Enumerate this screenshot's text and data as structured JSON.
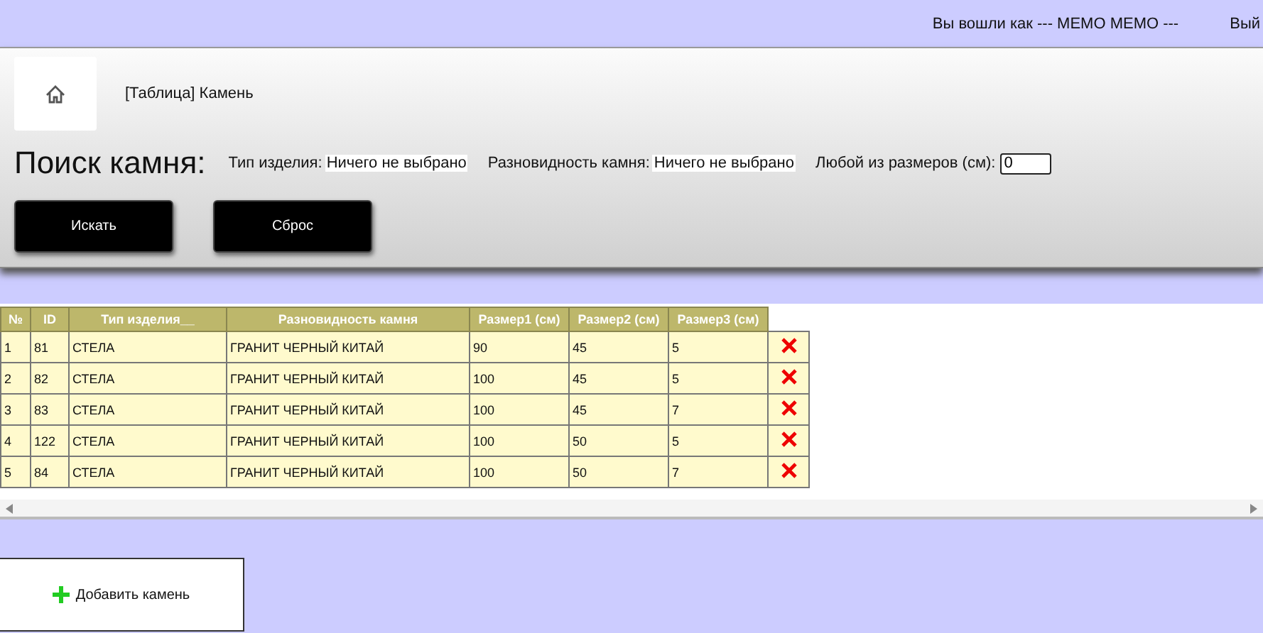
{
  "top_bar": {
    "logged_in_text": "Вы вошли как  --- MEMO MEMO ---",
    "logout_link": "Вый"
  },
  "breadcrumb": "[Таблица] Камень",
  "search": {
    "title": "Поиск камня:",
    "filters": [
      {
        "label": "Тип изделия:",
        "value": "Ничего не выбрано"
      },
      {
        "label": "Разновидность камня:",
        "value": "Ничего не выбрано"
      }
    ],
    "size_label": "Любой из размеров (см):",
    "size_value": "0",
    "buttons": [
      "Искать",
      "Сброс"
    ]
  },
  "table": {
    "columns": [
      "№",
      "ID",
      "Тип изделия__",
      "Разновидность камня",
      "Размер1 (см)",
      "Размер2 (см)",
      "Размер3 (см)"
    ],
    "rows": [
      {
        "cells": [
          "1",
          "81",
          "СТЕЛА",
          "ГРАНИТ ЧЕРНЫЙ КИТАЙ",
          "90",
          "45",
          "5"
        ]
      },
      {
        "cells": [
          "2",
          "82",
          "СТЕЛА",
          "ГРАНИТ ЧЕРНЫЙ КИТАЙ",
          "100",
          "45",
          "5"
        ]
      },
      {
        "cells": [
          "3",
          "83",
          "СТЕЛА",
          "ГРАНИТ ЧЕРНЫЙ КИТАЙ",
          "100",
          "45",
          "7"
        ]
      },
      {
        "cells": [
          "4",
          "122",
          "СТЕЛА",
          "ГРАНИТ ЧЕРНЫЙ КИТАЙ",
          "100",
          "50",
          "5"
        ]
      },
      {
        "cells": [
          "5",
          "84",
          "СТЕЛА",
          "ГРАНИТ ЧЕРНЫЙ КИТАЙ",
          "100",
          "50",
          "7"
        ]
      }
    ]
  },
  "add_button": "Добавить камень"
}
